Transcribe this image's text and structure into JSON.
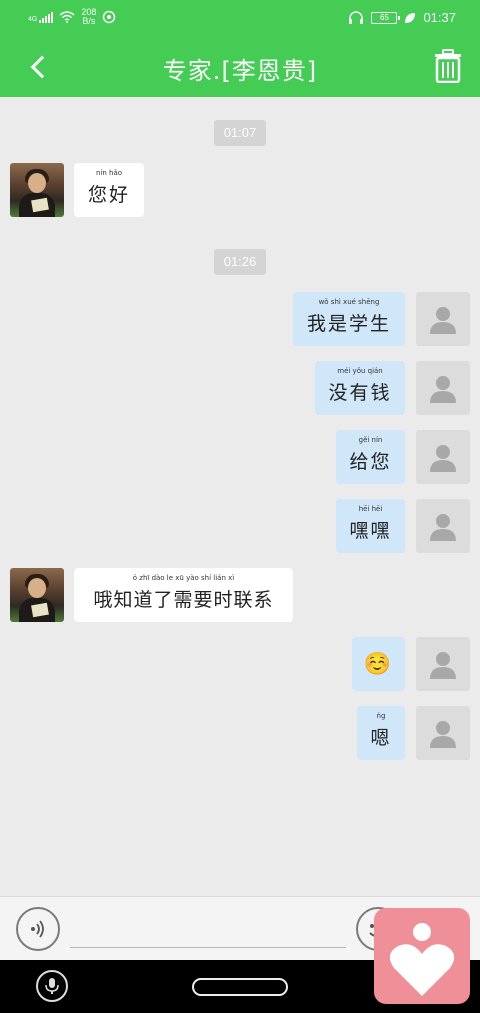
{
  "status_bar": {
    "net_type": "4G",
    "speed_value": "208",
    "speed_unit": "B/s",
    "battery": "65",
    "time": "01:37"
  },
  "header": {
    "title": "专家.[李恩贵]",
    "back_icon": "chevron-left-icon",
    "delete_icon": "trash-icon"
  },
  "messages": [
    {
      "type": "time",
      "text": "01:07"
    },
    {
      "type": "in",
      "text": "您好",
      "pinyin": "nín hǎo"
    },
    {
      "type": "time",
      "text": "01:26"
    },
    {
      "type": "out",
      "text": "我是学生",
      "pinyin": "wǒ shì xué shēng"
    },
    {
      "type": "out",
      "text": "没有钱",
      "pinyin": "méi yǒu qián"
    },
    {
      "type": "out",
      "text": "给您",
      "pinyin": "gěi nín"
    },
    {
      "type": "out",
      "text": "嘿嘿",
      "pinyin": "hēi hēi"
    },
    {
      "type": "in",
      "text": "哦知道了需要时联系",
      "pinyin": "ó zhī dào le xū yào shí lián xì"
    },
    {
      "type": "out",
      "text": "☺️",
      "pinyin": ""
    },
    {
      "type": "out",
      "text": "嗯",
      "pinyin": "ńg"
    }
  ],
  "input_bar": {
    "voice_icon": "voice-icon",
    "emoji_icon": "emoji-icon"
  },
  "colors": {
    "accent": "#44cc55",
    "incoming_bubble": "#ffffff",
    "outgoing_bubble": "#cfe7f9",
    "chat_background": "#ebebeb",
    "float_app": "#ef8f98"
  }
}
